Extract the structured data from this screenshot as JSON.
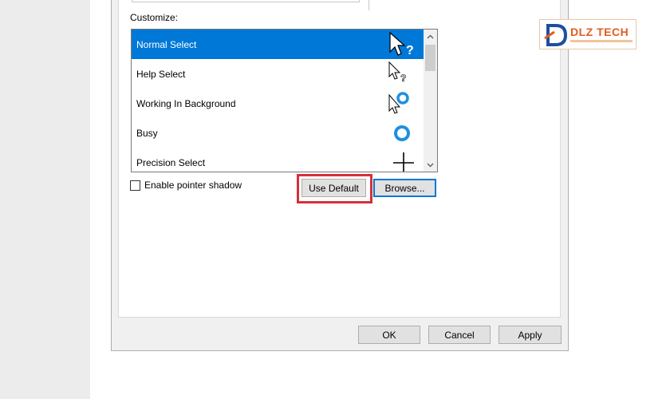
{
  "customize_label": "Customize:",
  "cursor_list": [
    {
      "label": "Normal Select",
      "icon": "arrow-question-cursor-icon",
      "selected": true
    },
    {
      "label": "Help Select",
      "icon": "small-arrow-question-cursor-icon",
      "selected": false
    },
    {
      "label": "Working In Background",
      "icon": "arrow-busy-ring-cursor-icon",
      "selected": false
    },
    {
      "label": "Busy",
      "icon": "busy-ring-cursor-icon",
      "selected": false
    },
    {
      "label": "Precision Select",
      "icon": "crosshair-cursor-icon",
      "selected": false
    }
  ],
  "pointer_shadow": {
    "label": "Enable pointer shadow",
    "checked": false
  },
  "buttons": {
    "use_default": "Use Default",
    "browse": "Browse...",
    "ok": "OK",
    "cancel": "Cancel",
    "apply": "Apply"
  },
  "logo": {
    "text": "DLZ TECH"
  },
  "colors": {
    "selection": "#0078d7",
    "highlight": "#d6303a",
    "busy_ring": "#1e90e0",
    "logo_orange": "#e35b1c",
    "logo_blue": "#1f4e9c"
  }
}
